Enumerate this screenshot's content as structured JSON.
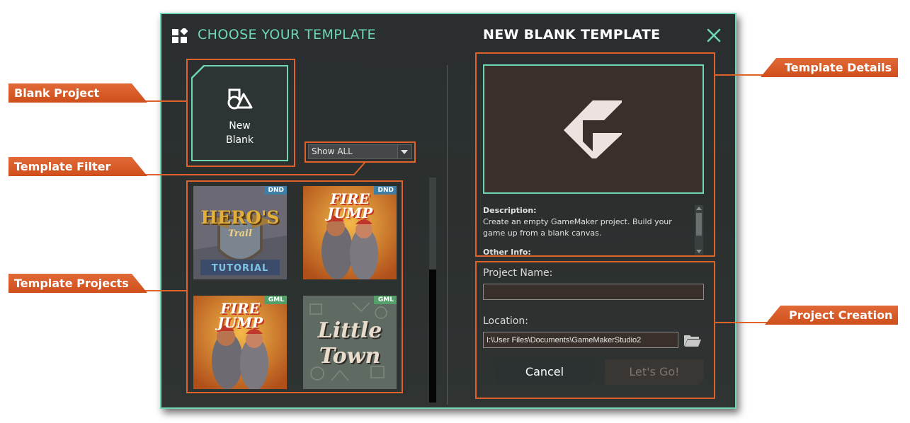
{
  "dialog": {
    "title_left": "CHOOSE YOUR TEMPLATE",
    "title_right": "NEW BLANK TEMPLATE"
  },
  "blank_tile": {
    "label": "New\nBlank"
  },
  "filter": {
    "selected": "Show ALL"
  },
  "templates": [
    {
      "title": "HERO'S",
      "subtitle": "Trail",
      "caption": "TUTORIAL",
      "badge": "DND"
    },
    {
      "title": "FIRE",
      "subtitle": "JUMP",
      "badge": "DND"
    },
    {
      "title": "FIRE",
      "subtitle": "JUMP",
      "badge": "GML"
    },
    {
      "title": "Little",
      "subtitle": "Town",
      "badge": "GML"
    }
  ],
  "details": {
    "description_label": "Description:",
    "description_text": "Create an empty GameMaker project. Build your game up from a blank canvas.",
    "other_info_label": "Other Info:"
  },
  "creation": {
    "name_label": "Project Name:",
    "name_value": "",
    "location_label": "Location:",
    "location_value": "I:\\User Files\\Documents\\GameMakerStudio2",
    "cancel_label": "Cancel",
    "go_label": "Let's Go!"
  },
  "callouts": {
    "blank_project": "Blank Project",
    "template_filter": "Template Filter",
    "template_projects": "Template Projects",
    "template_details": "Template Details",
    "project_creation": "Project Creation"
  },
  "colors": {
    "accent": "#6fd6b5",
    "callout": "#e0622b",
    "dialog_bg": "#2b302f",
    "panel_bg": "#3a302b"
  }
}
